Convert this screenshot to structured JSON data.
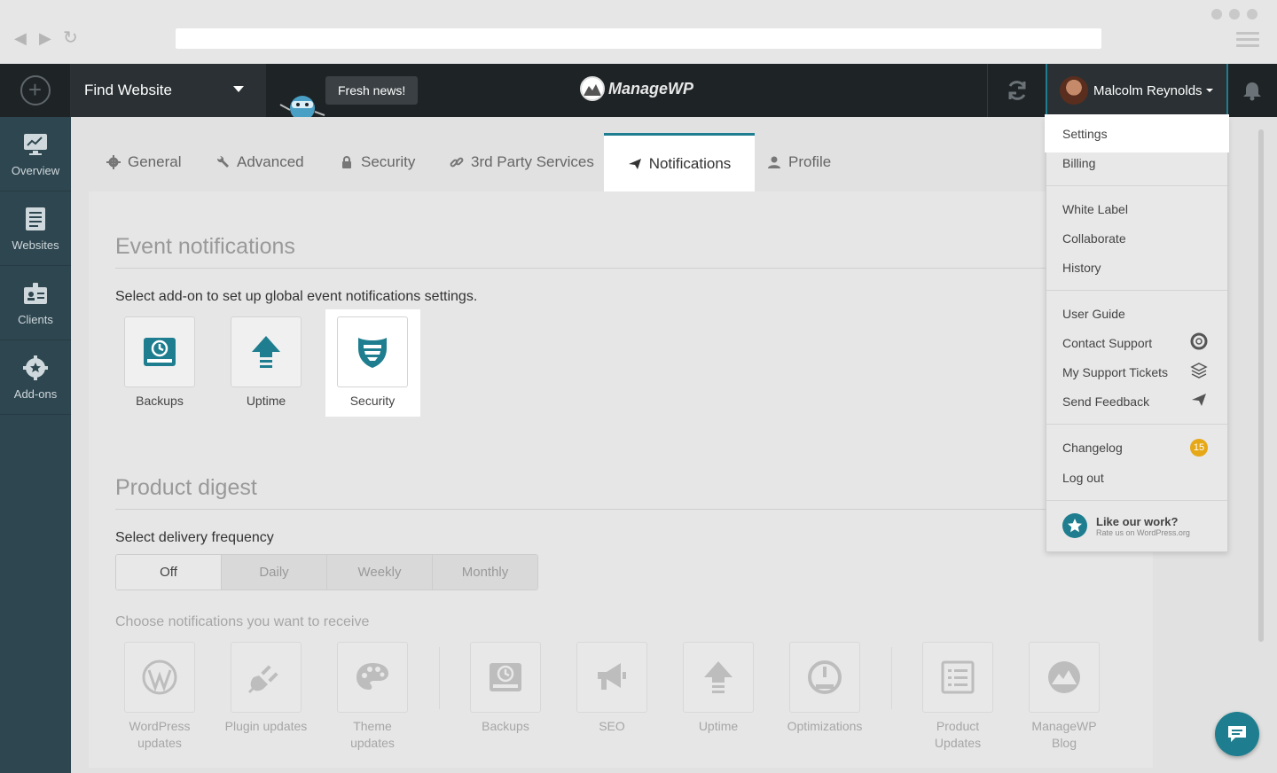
{
  "topbar": {
    "find_website": "Find Website",
    "fresh_news": "Fresh news!",
    "logo_text": "ManageWP",
    "user_name": "Malcolm Reynolds"
  },
  "sidebar": {
    "items": [
      {
        "label": "Overview",
        "icon": "monitor-chart-icon"
      },
      {
        "label": "Websites",
        "icon": "websites-list-icon"
      },
      {
        "label": "Clients",
        "icon": "clients-badge-icon"
      },
      {
        "label": "Add-ons",
        "icon": "gear-star-icon"
      }
    ]
  },
  "tabs": [
    {
      "label": "General",
      "icon": "gear-icon"
    },
    {
      "label": "Advanced",
      "icon": "wrench-icon"
    },
    {
      "label": "Security",
      "icon": "lock-icon"
    },
    {
      "label": "3rd Party Services",
      "icon": "link-icon"
    },
    {
      "label": "Notifications",
      "icon": "paper-plane-icon",
      "active": true
    },
    {
      "label": "Profile",
      "icon": "user-icon"
    }
  ],
  "event_notifications": {
    "title": "Event notifications",
    "subtitle": "Select add-on to set up global event notifications settings.",
    "addons": [
      {
        "label": "Backups"
      },
      {
        "label": "Uptime"
      },
      {
        "label": "Security",
        "selected": true
      }
    ]
  },
  "product_digest": {
    "title": "Product digest",
    "frequency_label": "Select delivery frequency",
    "frequency_options": [
      "Off",
      "Daily",
      "Weekly",
      "Monthly"
    ],
    "selected_frequency": "Off",
    "choose_label": "Choose notifications you want to receive",
    "notifications": [
      {
        "line1": "WordPress",
        "line2": "updates"
      },
      {
        "line1": "Plugin updates",
        "line2": ""
      },
      {
        "line1": "Theme",
        "line2": "updates"
      },
      {
        "line1": "Backups",
        "line2": ""
      },
      {
        "line1": "SEO",
        "line2": ""
      },
      {
        "line1": "Uptime",
        "line2": ""
      },
      {
        "line1": "Optimizations",
        "line2": ""
      },
      {
        "line1": "Product",
        "line2": "Updates"
      },
      {
        "line1": "ManageWP",
        "line2": "Blog"
      }
    ]
  },
  "user_menu": {
    "settings": "Settings",
    "billing": "Billing",
    "white_label": "White Label",
    "collaborate": "Collaborate",
    "history": "History",
    "user_guide": "User Guide",
    "contact_support": "Contact Support",
    "my_support_tickets": "My Support Tickets",
    "send_feedback": "Send Feedback",
    "changelog": "Changelog",
    "changelog_count": "15",
    "log_out": "Log out",
    "like_title": "Like our work?",
    "like_sub": "Rate us on WordPress.org"
  },
  "colors": {
    "accent": "#1e7e8f",
    "topbar": "#1e2326",
    "sidebar": "#2e4650",
    "badge": "#e6a817"
  }
}
